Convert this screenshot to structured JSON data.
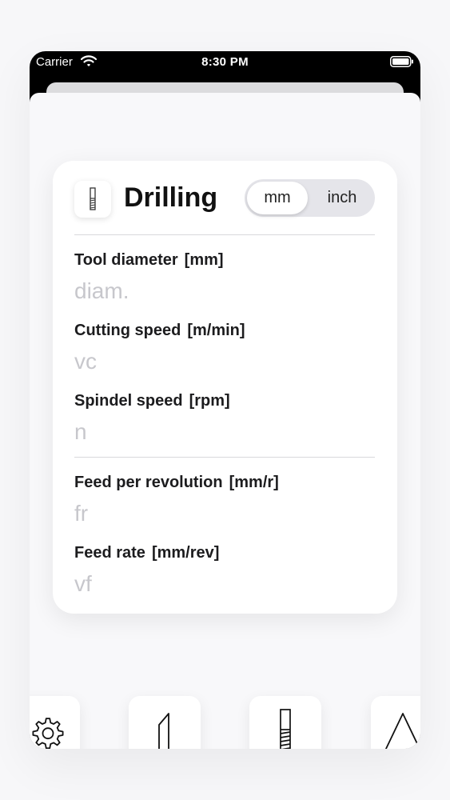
{
  "status_bar": {
    "carrier": "Carrier",
    "time": "8:30 PM"
  },
  "card": {
    "title": "Drilling",
    "unit_toggle": {
      "options": [
        "mm",
        "inch"
      ],
      "selected": "mm"
    },
    "fields": [
      {
        "label": "Tool diameter",
        "unit": "[mm]",
        "placeholder": "diam."
      },
      {
        "label": "Cutting speed",
        "unit": "[m/min]",
        "placeholder": "vc"
      },
      {
        "label": "Spindel speed",
        "unit": "[rpm]",
        "placeholder": "n"
      },
      {
        "label": "Feed per revolution",
        "unit": "[mm/r]",
        "placeholder": "fr"
      },
      {
        "label": "Feed rate",
        "unit": "[mm/rev]",
        "placeholder": "vf"
      }
    ]
  },
  "toolbar": {
    "items": [
      "gear-icon",
      "turning-tool-icon",
      "drill-icon",
      "triangle-icon"
    ]
  }
}
